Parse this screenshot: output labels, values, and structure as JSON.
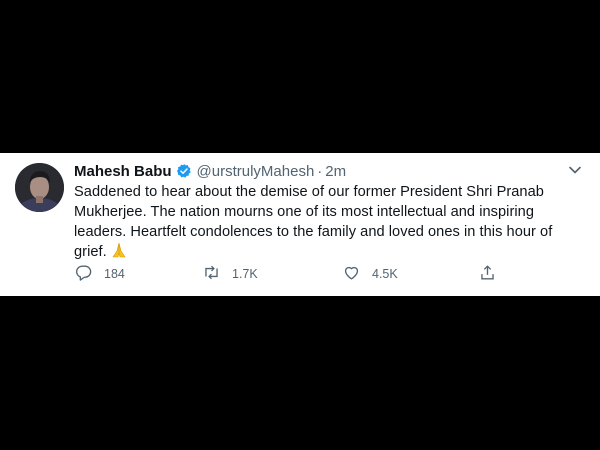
{
  "tweet": {
    "author_name": "Mahesh Babu",
    "handle": "@urstrulyMahesh",
    "separator": "·",
    "time": "2m",
    "text_lines": [
      "Saddened to hear about the demise of our former President Shri Pranab",
      "Mukherjee. The nation mourns one of its most intellectual and inspiring",
      "leaders. Heartfelt condolences to the family and loved ones in this hour of",
      "grief."
    ],
    "emoji": "🙏",
    "actions": {
      "reply_count": "184",
      "retweet_count": "1.7K",
      "like_count": "4.5K"
    }
  },
  "colors": {
    "background": "#000000",
    "card": "#ffffff",
    "text": "#0f1419",
    "muted": "#536471",
    "verified": "#1d9bf0"
  },
  "icons": [
    "avatar",
    "verified-badge-icon",
    "chevron-down-icon",
    "reply-icon",
    "retweet-icon",
    "like-icon",
    "share-icon",
    "folded-hands-emoji"
  ]
}
